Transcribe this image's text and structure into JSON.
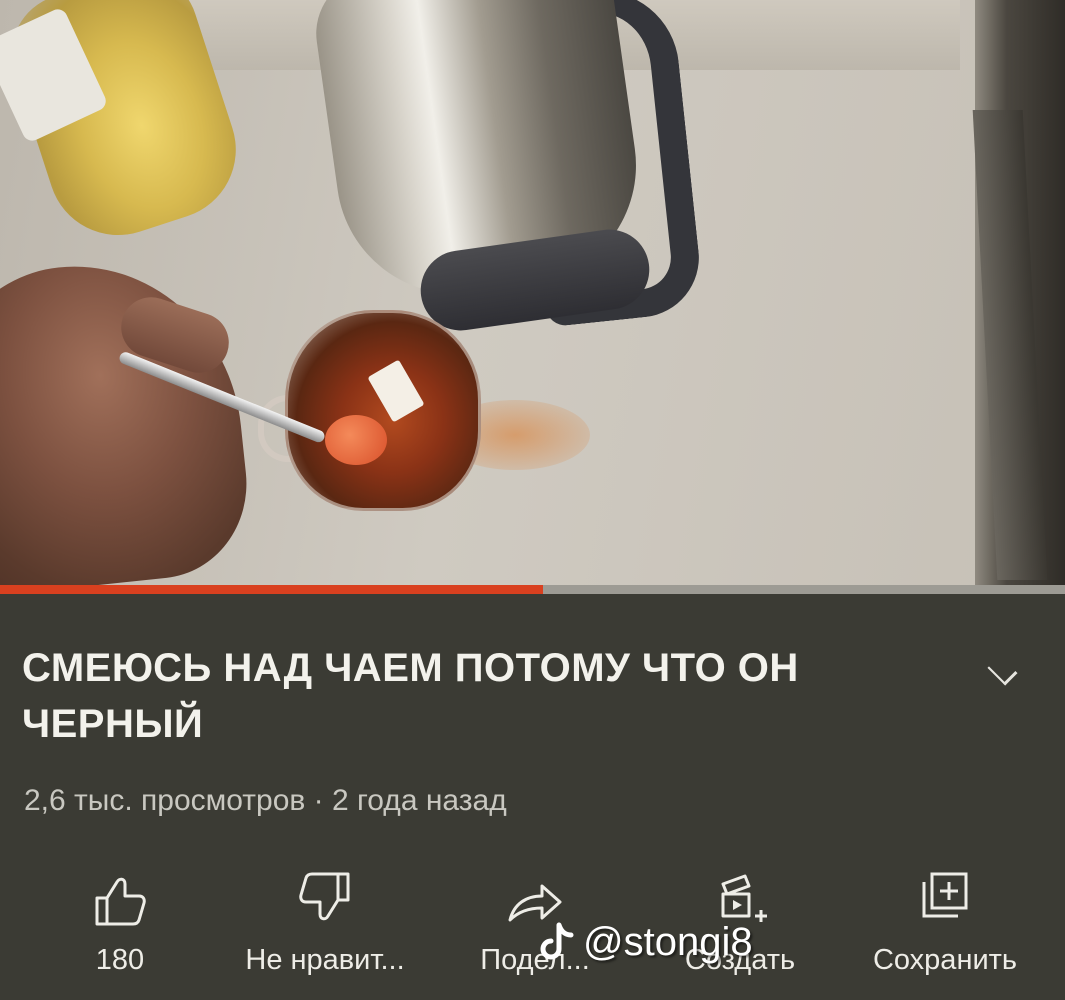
{
  "video": {
    "progress": 0.51
  },
  "info": {
    "title": "СМЕЮСЬ НАД ЧАЕМ ПОТОМУ ЧТО ОН ЧЕРНЫЙ",
    "stats": "2,6 тыс. просмотров · 2 года назад"
  },
  "actions": {
    "like": "180",
    "dislike": "Не нравит...",
    "share": "Подел...",
    "create": "Создать",
    "save": "Сохранить"
  },
  "watermark": {
    "handle": "@stongi8"
  },
  "icons": {
    "like": "thumb-up-icon",
    "dislike": "thumb-down-icon",
    "share": "share-arrow-icon",
    "create": "create-clip-icon",
    "save": "save-playlist-icon",
    "expand": "chevron-down-icon",
    "logo": "tiktok-logo-icon"
  },
  "colors": {
    "progress": "#d9401f",
    "panel": "#3b3b34",
    "text": "#f3f2ec"
  }
}
